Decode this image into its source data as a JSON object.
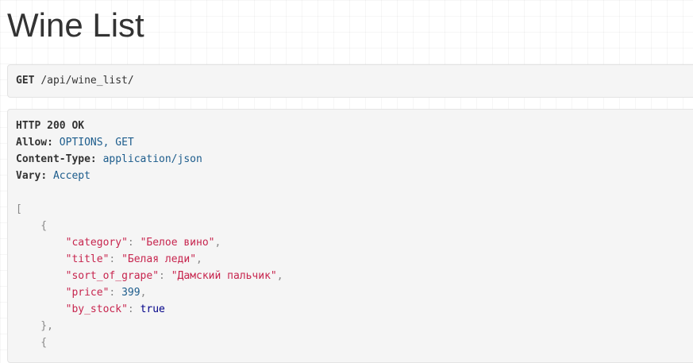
{
  "page": {
    "title": "Wine List"
  },
  "request": {
    "method": "GET",
    "path": "/api/wine_list/"
  },
  "response": {
    "status_line": "HTTP 200 OK",
    "headers": [
      {
        "name": "Allow",
        "value": "OPTIONS, GET"
      },
      {
        "name": "Content-Type",
        "value": "application/json"
      },
      {
        "name": "Vary",
        "value": "Accept"
      }
    ],
    "body": {
      "items": [
        {
          "category": "Белое вино",
          "title": "Белая леди",
          "sort_of_grape": "Дамский пальчик",
          "price": "399",
          "by_stock": "true"
        }
      ],
      "keys": {
        "category": "category",
        "title": "title",
        "sort_of_grape": "sort_of_grape",
        "price": "price",
        "by_stock": "by_stock"
      }
    }
  }
}
